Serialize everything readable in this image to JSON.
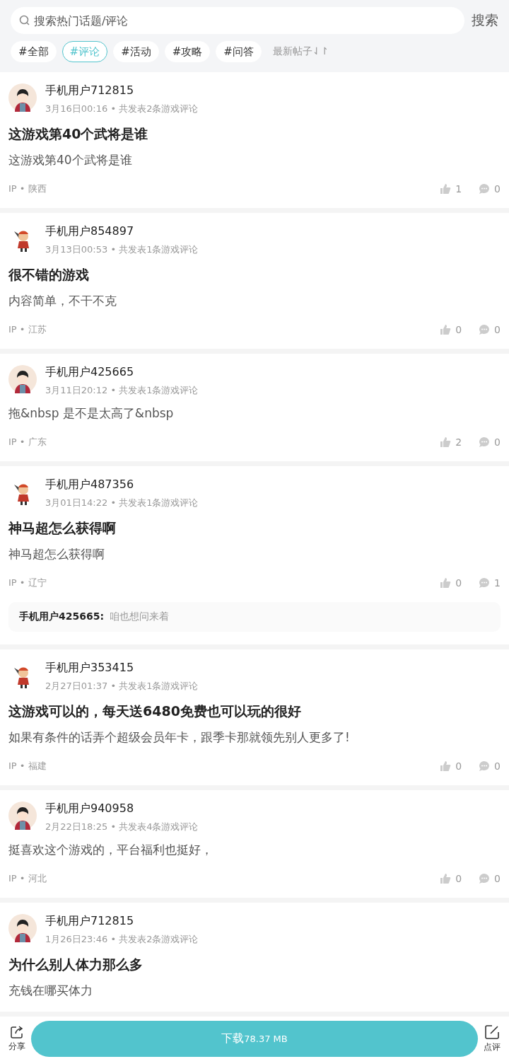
{
  "search": {
    "placeholder": "搜索热门话题/评论",
    "button": "搜索"
  },
  "filters": [
    {
      "label": "#全部",
      "selected": false
    },
    {
      "label": "#评论",
      "selected": true
    },
    {
      "label": "#活动",
      "selected": false
    },
    {
      "label": "#攻略",
      "selected": false
    },
    {
      "label": "#问答",
      "selected": false
    }
  ],
  "sort": {
    "label": "最新帖子",
    "icon": "⇃↾"
  },
  "posts": [
    {
      "avatar": {
        "kind": "boy"
      },
      "user": "手机用户712815",
      "meta": "3月16日00:16 • 共发表2条游戏评论",
      "title": "这游戏第40个武将是谁",
      "body": "这游戏第40个武将是谁",
      "ip": "IP • 陕西",
      "likes": "1",
      "comments": "0"
    },
    {
      "avatar": {
        "kind": "character"
      },
      "user": "手机用户854897",
      "meta": "3月13日00:53 • 共发表1条游戏评论",
      "title": "很不错的游戏",
      "body": "内容简单，不干不克",
      "ip": "IP • 江苏",
      "likes": "0",
      "comments": "0"
    },
    {
      "avatar": {
        "kind": "boy"
      },
      "user": "手机用户425665",
      "meta": "3月11日20:12 • 共发表1条游戏评论",
      "body": "拖&nbsp 是不是太高了&nbsp",
      "ip": "IP • 广东",
      "likes": "2",
      "comments": "0"
    },
    {
      "avatar": {
        "kind": "character"
      },
      "user": "手机用户487356",
      "meta": "3月01日14:22 • 共发表1条游戏评论",
      "title": "神马超怎么获得啊",
      "body": "神马超怎么获得啊",
      "ip": "IP • 辽宁",
      "likes": "0",
      "comments": "1",
      "reply": {
        "user": "手机用户425665:",
        "text": "咱也想问来着"
      }
    },
    {
      "avatar": {
        "kind": "character"
      },
      "user": "手机用户353415",
      "meta": "2月27日01:37 • 共发表1条游戏评论",
      "title": "这游戏可以的，每天送6480免费也可以玩的很好",
      "body": "如果有条件的话弄个超级会员年卡，跟季卡那就领先别人更多了!",
      "ip": "IP • 福建",
      "likes": "0",
      "comments": "0"
    },
    {
      "avatar": {
        "kind": "boy"
      },
      "user": "手机用户940958",
      "meta": "2月22日18:25 • 共发表4条游戏评论",
      "body": "挺喜欢这个游戏的，平台福利也挺好，",
      "ip": "IP • 河北",
      "likes": "0",
      "comments": "0"
    },
    {
      "avatar": {
        "kind": "boy"
      },
      "user": "手机用户712815",
      "meta": "1月26日23:46 • 共发表2条游戏评论",
      "title": "为什么别人体力那么多",
      "body": "充钱在哪买体力"
    }
  ],
  "bottom": {
    "share": "分享",
    "download": "下载",
    "size": "78.37 MB",
    "review": "点评"
  }
}
